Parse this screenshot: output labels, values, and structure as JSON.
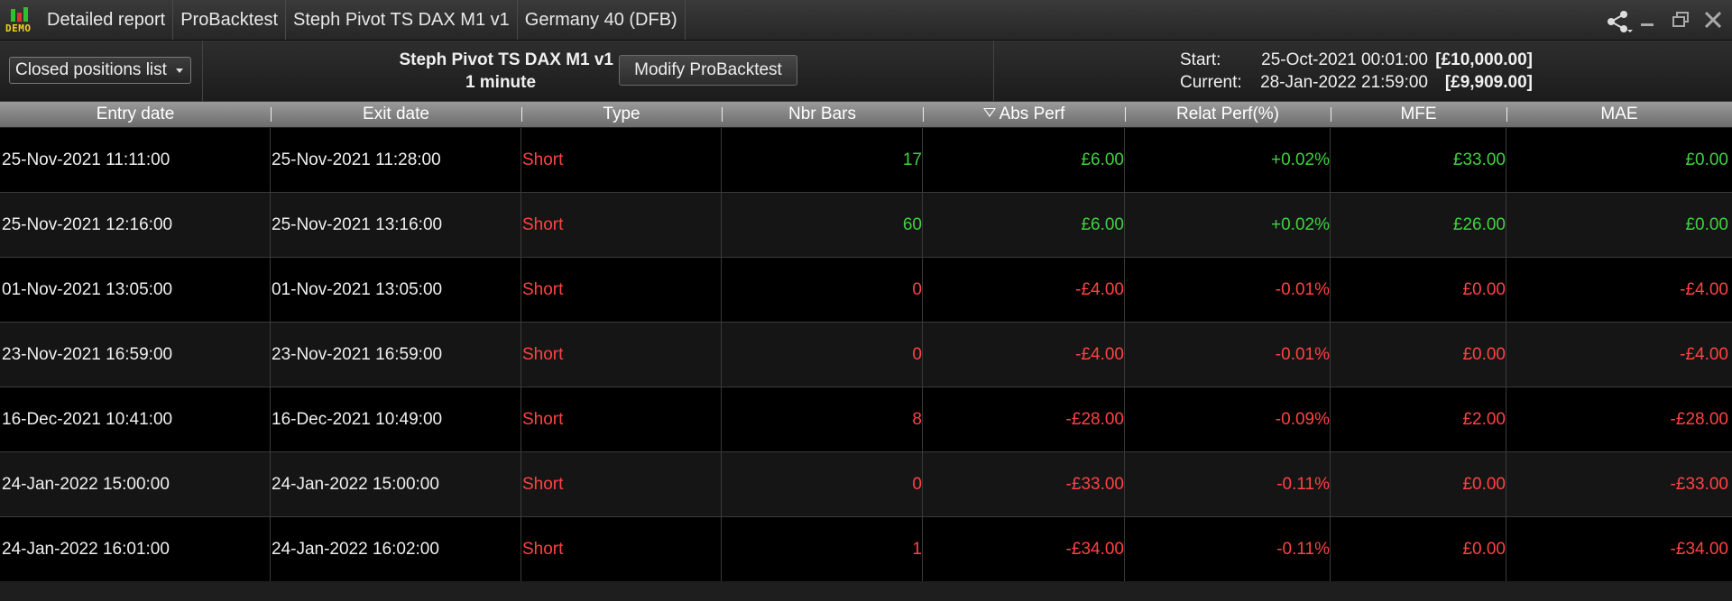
{
  "titlebar": {
    "logo_text": "DEMO",
    "segments": [
      "Detailed report",
      "ProBacktest",
      "Steph Pivot TS DAX M1 v1",
      "Germany 40 (DFB)"
    ],
    "icons": [
      "share-icon",
      "minimize-icon",
      "restore-icon",
      "close-icon"
    ]
  },
  "header": {
    "view_select": "Closed positions list",
    "strategy_name": "Steph Pivot TS DAX M1 v1",
    "timeframe": "1 minute",
    "modify_button": "Modify ProBacktest",
    "start_label": "Start:",
    "start_date": "25-Oct-2021 00:01:00",
    "start_capital": "[£10,000.00]",
    "current_label": "Current:",
    "current_date": "28-Jan-2022 21:59:00",
    "current_capital": "[£9,909.00]"
  },
  "table": {
    "columns": [
      "Entry date",
      "Exit date",
      "Type",
      "Nbr Bars",
      "Abs Perf",
      "Relat Perf(%)",
      "MFE",
      "MAE"
    ],
    "sorted_column": "Abs Perf",
    "rows": [
      {
        "entry": "25-Nov-2021 11:11:00",
        "exit": "25-Nov-2021 11:28:00",
        "type": "Short",
        "bars": "17",
        "abs": "£6.00",
        "rel": "+0.02%",
        "mfe": "£33.00",
        "mae": "£0.00",
        "sign": "pos"
      },
      {
        "entry": "25-Nov-2021 12:16:00",
        "exit": "25-Nov-2021 13:16:00",
        "type": "Short",
        "bars": "60",
        "abs": "£6.00",
        "rel": "+0.02%",
        "mfe": "£26.00",
        "mae": "£0.00",
        "sign": "pos"
      },
      {
        "entry": "01-Nov-2021 13:05:00",
        "exit": "01-Nov-2021 13:05:00",
        "type": "Short",
        "bars": "0",
        "abs": "-£4.00",
        "rel": "-0.01%",
        "mfe": "£0.00",
        "mae": "-£4.00",
        "sign": "neg"
      },
      {
        "entry": "23-Nov-2021 16:59:00",
        "exit": "23-Nov-2021 16:59:00",
        "type": "Short",
        "bars": "0",
        "abs": "-£4.00",
        "rel": "-0.01%",
        "mfe": "£0.00",
        "mae": "-£4.00",
        "sign": "neg"
      },
      {
        "entry": "16-Dec-2021 10:41:00",
        "exit": "16-Dec-2021 10:49:00",
        "type": "Short",
        "bars": "8",
        "abs": "-£28.00",
        "rel": "-0.09%",
        "mfe": "£2.00",
        "mae": "-£28.00",
        "sign": "neg"
      },
      {
        "entry": "24-Jan-2022 15:00:00",
        "exit": "24-Jan-2022 15:00:00",
        "type": "Short",
        "bars": "0",
        "abs": "-£33.00",
        "rel": "-0.11%",
        "mfe": "£0.00",
        "mae": "-£33.00",
        "sign": "neg"
      },
      {
        "entry": "24-Jan-2022 16:01:00",
        "exit": "24-Jan-2022 16:02:00",
        "type": "Short",
        "bars": "1",
        "abs": "-£34.00",
        "rel": "-0.11%",
        "mfe": "£0.00",
        "mae": "-£34.00",
        "sign": "neg"
      }
    ]
  },
  "colors": {
    "positive": "#3fd23f",
    "negative": "#ff4242",
    "demo_logo": "#f2d21c"
  }
}
